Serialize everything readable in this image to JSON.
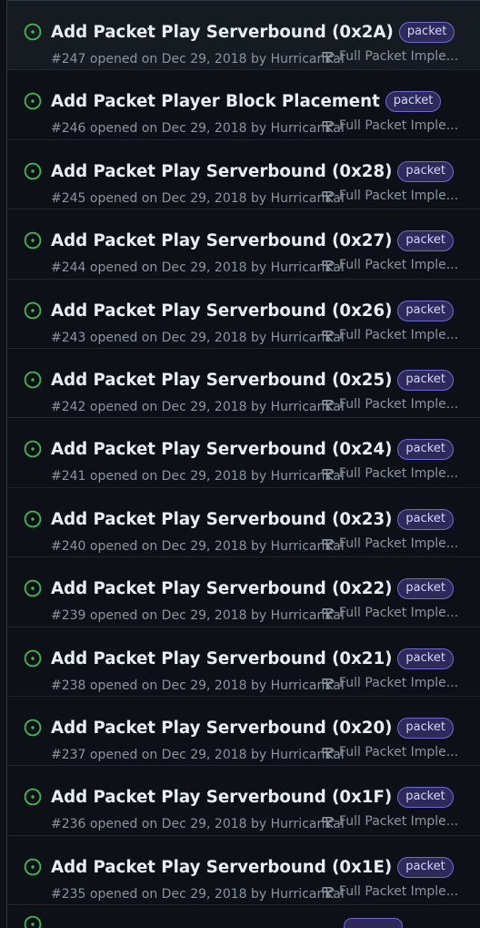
{
  "issues": [
    {
      "title": "Add Packet Play Serverbound (0x2A)",
      "label": "packet",
      "meta": "#247 opened on Dec 29, 2018 by HurricanKai",
      "milestone": "Full Packet Imple..."
    },
    {
      "title": "Add Packet Player Block Placement",
      "label": "packet",
      "meta": "#246 opened on Dec 29, 2018 by HurricanKai",
      "milestone": "Full Packet Imple..."
    },
    {
      "title": "Add Packet Play Serverbound (0x28)",
      "label": "packet",
      "meta": "#245 opened on Dec 29, 2018 by HurricanKai",
      "milestone": "Full Packet Imple..."
    },
    {
      "title": "Add Packet Play Serverbound (0x27)",
      "label": "packet",
      "meta": "#244 opened on Dec 29, 2018 by HurricanKai",
      "milestone": "Full Packet Imple..."
    },
    {
      "title": "Add Packet Play Serverbound (0x26)",
      "label": "packet",
      "meta": "#243 opened on Dec 29, 2018 by HurricanKai",
      "milestone": "Full Packet Imple..."
    },
    {
      "title": "Add Packet Play Serverbound (0x25)",
      "label": "packet",
      "meta": "#242 opened on Dec 29, 2018 by HurricanKai",
      "milestone": "Full Packet Imple..."
    },
    {
      "title": "Add Packet Play Serverbound (0x24)",
      "label": "packet",
      "meta": "#241 opened on Dec 29, 2018 by HurricanKai",
      "milestone": "Full Packet Imple..."
    },
    {
      "title": "Add Packet Play Serverbound (0x23)",
      "label": "packet",
      "meta": "#240 opened on Dec 29, 2018 by HurricanKai",
      "milestone": "Full Packet Imple..."
    },
    {
      "title": "Add Packet Play Serverbound (0x22)",
      "label": "packet",
      "meta": "#239 opened on Dec 29, 2018 by HurricanKai",
      "milestone": "Full Packet Imple..."
    },
    {
      "title": "Add Packet Play Serverbound (0x21)",
      "label": "packet",
      "meta": "#238 opened on Dec 29, 2018 by HurricanKai",
      "milestone": "Full Packet Imple..."
    },
    {
      "title": "Add Packet Play Serverbound (0x20)",
      "label": "packet",
      "meta": "#237 opened on Dec 29, 2018 by HurricanKai",
      "milestone": "Full Packet Imple..."
    },
    {
      "title": "Add Packet Play Serverbound (0x1F)",
      "label": "packet",
      "meta": "#236 opened on Dec 29, 2018 by HurricanKai",
      "milestone": "Full Packet Imple..."
    },
    {
      "title": "Add Packet Play Serverbound (0x1E)",
      "label": "packet",
      "meta": "#235 opened on Dec 29, 2018 by HurricanKai",
      "milestone": "Full Packet Imple..."
    }
  ],
  "icons": {
    "status": "open-issue-icon",
    "milestone": "milestone-icon"
  },
  "colors": {
    "background": "#0d1117",
    "open_status": "#3fb950",
    "title": "#e6edf3",
    "muted": "#8b949e",
    "label_border": "#6f6ad6",
    "label_background": "#2d2a59"
  }
}
